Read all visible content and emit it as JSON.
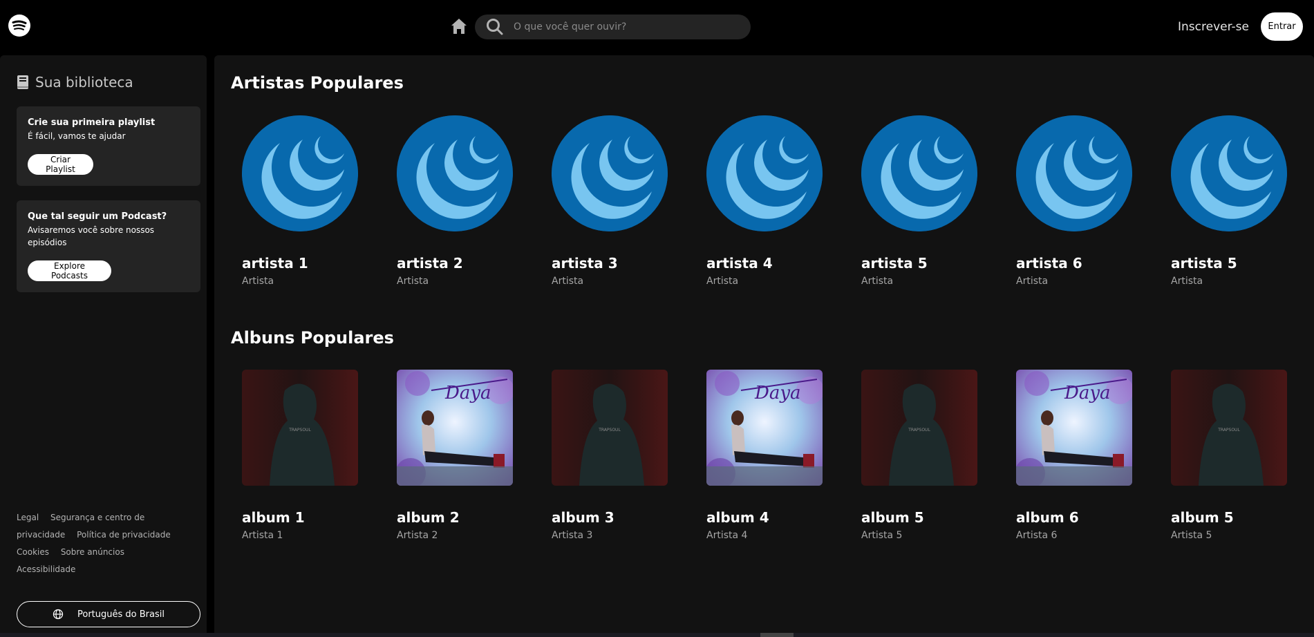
{
  "topbar": {
    "search_placeholder": "O que você quer ouvir?",
    "signup_label": "Inscrever-se",
    "login_label": "Entrar"
  },
  "sidebar": {
    "library_title": "Sua biblioteca",
    "playlist_card": {
      "title": "Crie sua primeira playlist",
      "text": "É fácil, vamos te ajudar",
      "button": "Criar Playlist"
    },
    "podcast_card": {
      "title": "Que tal seguir um Podcast?",
      "text": "Avisaremos você sobre nossos episódios",
      "button": "Explore Podcasts"
    },
    "footer_links": [
      "Legal",
      "Segurança e centro de privacidade",
      "Política de privacidade",
      "Cookies",
      "Sobre anúncios",
      "Acessibilidade"
    ],
    "language_button": "Português do Brasil"
  },
  "main": {
    "artists_title": "Artistas Populares",
    "artists": [
      {
        "name": "artista 1",
        "subtitle": "Artista"
      },
      {
        "name": "artista 2",
        "subtitle": "Artista"
      },
      {
        "name": "artista 3",
        "subtitle": "Artista"
      },
      {
        "name": "artista 4",
        "subtitle": "Artista"
      },
      {
        "name": "artista 5",
        "subtitle": "Artista"
      },
      {
        "name": "artista 6",
        "subtitle": "Artista"
      },
      {
        "name": "artista 5",
        "subtitle": "Artista"
      }
    ],
    "albums_title": "Albuns Populares",
    "albums": [
      {
        "name": "album 1",
        "artist": "Artista 1",
        "cover": "trapsoul",
        "cover_text": "TRAPSOUL"
      },
      {
        "name": "album 2",
        "artist": "Artista 2",
        "cover": "daya",
        "cover_text": "Daya"
      },
      {
        "name": "album 3",
        "artist": "Artista 3",
        "cover": "trapsoul",
        "cover_text": "TRAPSOUL"
      },
      {
        "name": "album 4",
        "artist": "Artista 4",
        "cover": "daya",
        "cover_text": "Daya"
      },
      {
        "name": "album 5",
        "artist": "Artista 5",
        "cover": "trapsoul",
        "cover_text": "TRAPSOUL"
      },
      {
        "name": "album 6",
        "artist": "Artista 6",
        "cover": "daya",
        "cover_text": "Daya"
      },
      {
        "name": "album 5",
        "artist": "Artista 5",
        "cover": "trapsoul",
        "cover_text": "TRAPSOUL"
      }
    ]
  },
  "colors": {
    "artist_circle": "#0869ad",
    "artist_moon": "#78c5f0",
    "panel_bg": "#121212",
    "card_bg": "#242424"
  }
}
